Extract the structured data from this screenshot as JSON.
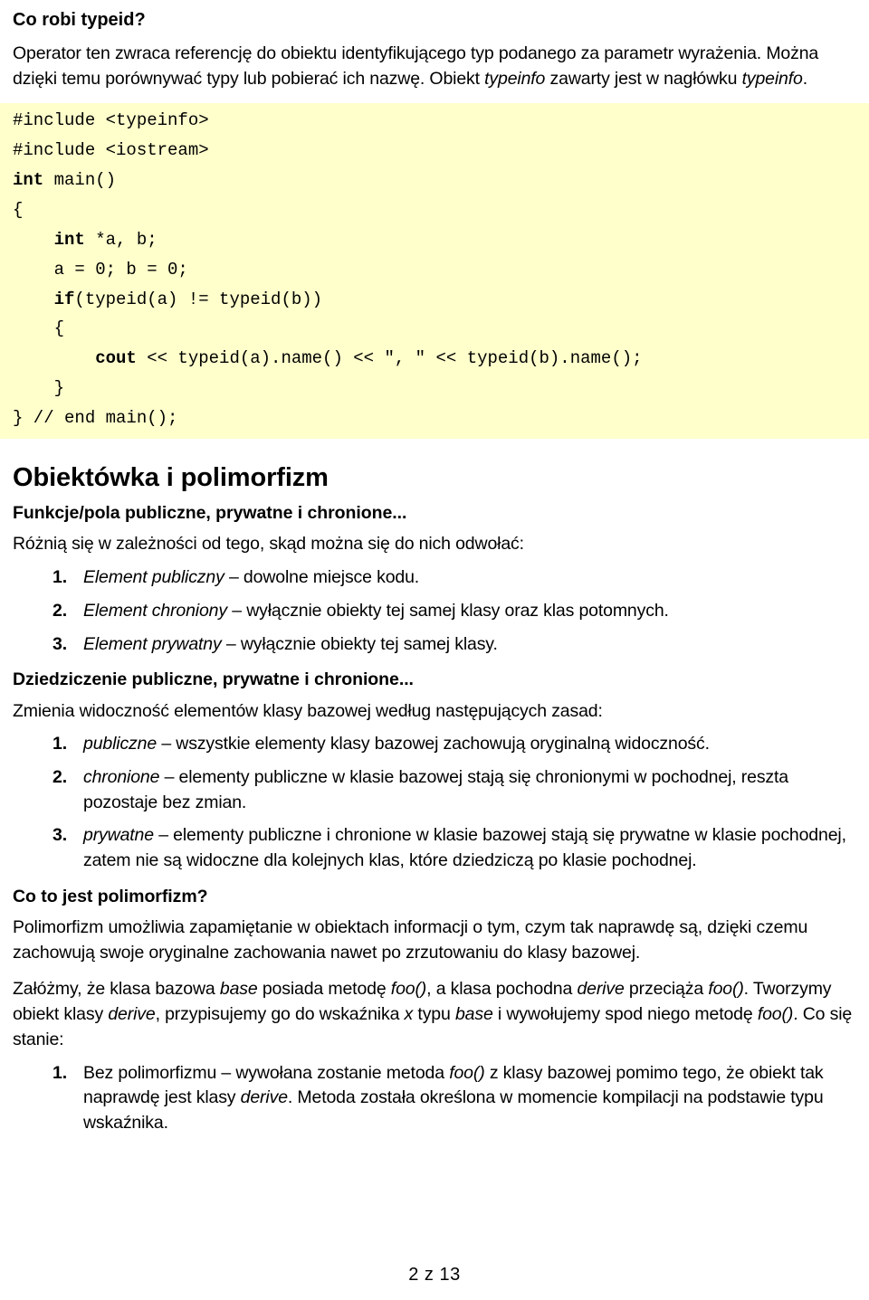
{
  "document": {
    "language": "pl",
    "colors": {
      "text": "#000000",
      "page_background": "#ffffff",
      "code_background": "#ffffcc"
    }
  },
  "top_section": {
    "heading": "Co robi typeid?",
    "paragraph": {
      "part1": "Operator ten zwraca referencję do obiektu identyfikującego typ podanego za parametr wyrażenia. Można dzięki temu porównywać typy lub pobierać ich nazwę. Obiekt ",
      "italic1": "typeinfo",
      "part2": " zawarty jest w nagłówku ",
      "italic2": "typeinfo",
      "part3": "."
    }
  },
  "code_block": {
    "language": "cpp",
    "lines": [
      {
        "indent": 0,
        "keyword": "",
        "rest": "#include <typeinfo>"
      },
      {
        "indent": 0,
        "keyword": "",
        "rest": "#include <iostream>"
      },
      {
        "indent": 0,
        "keyword": "int",
        "rest": " main()"
      },
      {
        "indent": 0,
        "keyword": "",
        "rest": "{"
      },
      {
        "indent": 1,
        "keyword": "int",
        "rest": " *a, b;"
      },
      {
        "indent": 1,
        "keyword": "",
        "rest": "a = 0; b = 0;"
      },
      {
        "indent": 1,
        "keyword": "if",
        "rest": "(typeid(a) != typeid(b))"
      },
      {
        "indent": 1,
        "keyword": "",
        "rest": "{"
      },
      {
        "indent": 2,
        "keyword": "cout",
        "rest": " << typeid(a).name() << \", \" << typeid(b).name();"
      },
      {
        "indent": 1,
        "keyword": "",
        "rest": "}"
      },
      {
        "indent": 0,
        "keyword": "",
        "rest": "} // end main();"
      }
    ]
  },
  "oop_section": {
    "heading": "Obiektówka i polimorfizm",
    "subsection_access": {
      "heading": "Funkcje/pola publiczne, prywatne i chronione...",
      "intro": "Różnią się w zależności od tego, skąd można się do nich odwołać:",
      "items": [
        {
          "term": "Element publiczny",
          "rest": " – dowolne miejsce kodu."
        },
        {
          "term": "Element chroniony",
          "rest": " – wyłącznie obiekty tej samej klasy oraz klas potomnych."
        },
        {
          "term": "Element prywatny",
          "rest": " – wyłącznie obiekty tej samej klasy."
        }
      ]
    },
    "subsection_inheritance": {
      "heading": "Dziedziczenie publiczne, prywatne i chronione...",
      "intro": "Zmienia widoczność elementów klasy bazowej według następujących zasad:",
      "items": [
        {
          "term": "publiczne",
          "rest": " – wszystkie elementy klasy bazowej zachowują oryginalną widoczność."
        },
        {
          "term": "chronione",
          "rest": " – elementy publiczne w klasie bazowej stają się chronionymi w pochodnej, reszta pozostaje bez zmian."
        },
        {
          "term": "prywatne",
          "rest": " – elementy publiczne i chronione w klasie bazowej stają się prywatne w klasie pochodnej, zatem nie są widoczne dla kolejnych klas, które dziedziczą po klasie pochodnej."
        }
      ]
    },
    "subsection_polymorphism": {
      "heading": "Co to jest polimorfizm?",
      "paragraph1": "Polimorfizm umożliwia zapamiętanie w obiektach informacji o tym, czym tak naprawdę są, dzięki czemu zachowują swoje oryginalne zachowania nawet po zrzutowaniu do klasy bazowej.",
      "paragraph2": {
        "p1": "Załóżmy, że klasa bazowa ",
        "i1": "base",
        "p2": " posiada metodę ",
        "i2": "foo()",
        "p3": ", a klasa pochodna ",
        "i3": "derive",
        "p4": " przeciąża ",
        "i4": "foo()",
        "p5": ". Tworzymy obiekt klasy ",
        "i5": "derive",
        "p6": ", przypisujemy go do wskaźnika ",
        "i6": "x",
        "p7": " typu ",
        "i7": "base",
        "p8": " i wywołujemy spod niego metodę ",
        "i8": "foo()",
        "p9": ". Co się stanie:"
      },
      "items": [
        {
          "p1": "Bez polimorfizmu – wywołana zostanie metoda ",
          "i1": "foo()",
          "p2": " z klasy bazowej pomimo tego, że obiekt tak naprawdę jest klasy ",
          "i2": "derive",
          "p3": ". Metoda została określona w momencie kompilacji na podstawie typu wskaźnika."
        }
      ]
    }
  },
  "footer": {
    "page_indicator": "2 z 13"
  }
}
